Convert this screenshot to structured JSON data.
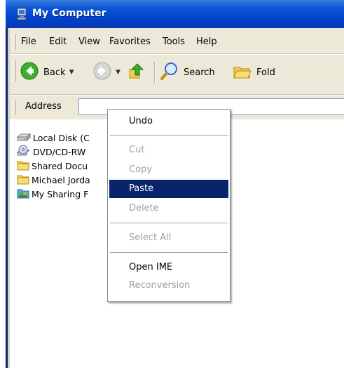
{
  "window": {
    "title": "My Computer",
    "title_icon": "computer-icon",
    "accent_color": "#0a56d8"
  },
  "menubar": {
    "items": [
      "File",
      "Edit",
      "View",
      "Favorites",
      "Tools",
      "Help"
    ]
  },
  "toolbar": {
    "back_label": "Back",
    "search_label": "Search",
    "folders_label": "Fold",
    "icons": [
      "back-arrow-icon",
      "forward-arrow-icon",
      "up-folder-icon",
      "search-icon",
      "folders-icon"
    ]
  },
  "addressbar": {
    "label": "Address",
    "value": ""
  },
  "file_list": [
    {
      "name": "Local Disk (C",
      "icon": "hard-disk-icon"
    },
    {
      "name": "DVD/CD-RW",
      "icon": "optical-drive-icon"
    },
    {
      "name": "Shared Docu",
      "icon": "folder-icon"
    },
    {
      "name": "Michael Jorda",
      "icon": "folder-icon"
    },
    {
      "name": "My Sharing F",
      "icon": "shared-folder-icon"
    }
  ],
  "context_menu": {
    "items": [
      {
        "label": "Undo",
        "enabled": true
      },
      {
        "label": "Cut",
        "enabled": false
      },
      {
        "label": "Copy",
        "enabled": false
      },
      {
        "label": "Paste",
        "enabled": true,
        "highlighted": true
      },
      {
        "label": "Delete",
        "enabled": false
      },
      {
        "label": "Select All",
        "enabled": false
      },
      {
        "label": "Open IME",
        "enabled": true
      },
      {
        "label": "Reconversion",
        "enabled": false
      }
    ],
    "highlight_color": "#0a246a"
  }
}
